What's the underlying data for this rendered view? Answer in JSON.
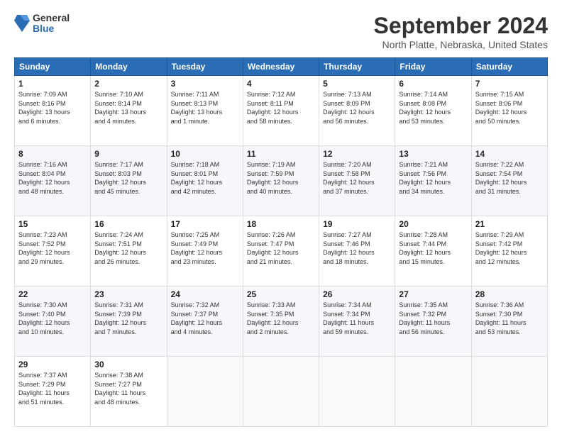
{
  "header": {
    "logo": {
      "general": "General",
      "blue": "Blue"
    },
    "title": "September 2024",
    "location": "North Platte, Nebraska, United States"
  },
  "calendar": {
    "headers": [
      "Sunday",
      "Monday",
      "Tuesday",
      "Wednesday",
      "Thursday",
      "Friday",
      "Saturday"
    ],
    "weeks": [
      [
        {
          "day": "1",
          "info": "Sunrise: 7:09 AM\nSunset: 8:16 PM\nDaylight: 13 hours\nand 6 minutes."
        },
        {
          "day": "2",
          "info": "Sunrise: 7:10 AM\nSunset: 8:14 PM\nDaylight: 13 hours\nand 4 minutes."
        },
        {
          "day": "3",
          "info": "Sunrise: 7:11 AM\nSunset: 8:13 PM\nDaylight: 13 hours\nand 1 minute."
        },
        {
          "day": "4",
          "info": "Sunrise: 7:12 AM\nSunset: 8:11 PM\nDaylight: 12 hours\nand 58 minutes."
        },
        {
          "day": "5",
          "info": "Sunrise: 7:13 AM\nSunset: 8:09 PM\nDaylight: 12 hours\nand 56 minutes."
        },
        {
          "day": "6",
          "info": "Sunrise: 7:14 AM\nSunset: 8:08 PM\nDaylight: 12 hours\nand 53 minutes."
        },
        {
          "day": "7",
          "info": "Sunrise: 7:15 AM\nSunset: 8:06 PM\nDaylight: 12 hours\nand 50 minutes."
        }
      ],
      [
        {
          "day": "8",
          "info": "Sunrise: 7:16 AM\nSunset: 8:04 PM\nDaylight: 12 hours\nand 48 minutes."
        },
        {
          "day": "9",
          "info": "Sunrise: 7:17 AM\nSunset: 8:03 PM\nDaylight: 12 hours\nand 45 minutes."
        },
        {
          "day": "10",
          "info": "Sunrise: 7:18 AM\nSunset: 8:01 PM\nDaylight: 12 hours\nand 42 minutes."
        },
        {
          "day": "11",
          "info": "Sunrise: 7:19 AM\nSunset: 7:59 PM\nDaylight: 12 hours\nand 40 minutes."
        },
        {
          "day": "12",
          "info": "Sunrise: 7:20 AM\nSunset: 7:58 PM\nDaylight: 12 hours\nand 37 minutes."
        },
        {
          "day": "13",
          "info": "Sunrise: 7:21 AM\nSunset: 7:56 PM\nDaylight: 12 hours\nand 34 minutes."
        },
        {
          "day": "14",
          "info": "Sunrise: 7:22 AM\nSunset: 7:54 PM\nDaylight: 12 hours\nand 31 minutes."
        }
      ],
      [
        {
          "day": "15",
          "info": "Sunrise: 7:23 AM\nSunset: 7:52 PM\nDaylight: 12 hours\nand 29 minutes."
        },
        {
          "day": "16",
          "info": "Sunrise: 7:24 AM\nSunset: 7:51 PM\nDaylight: 12 hours\nand 26 minutes."
        },
        {
          "day": "17",
          "info": "Sunrise: 7:25 AM\nSunset: 7:49 PM\nDaylight: 12 hours\nand 23 minutes."
        },
        {
          "day": "18",
          "info": "Sunrise: 7:26 AM\nSunset: 7:47 PM\nDaylight: 12 hours\nand 21 minutes."
        },
        {
          "day": "19",
          "info": "Sunrise: 7:27 AM\nSunset: 7:46 PM\nDaylight: 12 hours\nand 18 minutes."
        },
        {
          "day": "20",
          "info": "Sunrise: 7:28 AM\nSunset: 7:44 PM\nDaylight: 12 hours\nand 15 minutes."
        },
        {
          "day": "21",
          "info": "Sunrise: 7:29 AM\nSunset: 7:42 PM\nDaylight: 12 hours\nand 12 minutes."
        }
      ],
      [
        {
          "day": "22",
          "info": "Sunrise: 7:30 AM\nSunset: 7:40 PM\nDaylight: 12 hours\nand 10 minutes."
        },
        {
          "day": "23",
          "info": "Sunrise: 7:31 AM\nSunset: 7:39 PM\nDaylight: 12 hours\nand 7 minutes."
        },
        {
          "day": "24",
          "info": "Sunrise: 7:32 AM\nSunset: 7:37 PM\nDaylight: 12 hours\nand 4 minutes."
        },
        {
          "day": "25",
          "info": "Sunrise: 7:33 AM\nSunset: 7:35 PM\nDaylight: 12 hours\nand 2 minutes."
        },
        {
          "day": "26",
          "info": "Sunrise: 7:34 AM\nSunset: 7:34 PM\nDaylight: 11 hours\nand 59 minutes."
        },
        {
          "day": "27",
          "info": "Sunrise: 7:35 AM\nSunset: 7:32 PM\nDaylight: 11 hours\nand 56 minutes."
        },
        {
          "day": "28",
          "info": "Sunrise: 7:36 AM\nSunset: 7:30 PM\nDaylight: 11 hours\nand 53 minutes."
        }
      ],
      [
        {
          "day": "29",
          "info": "Sunrise: 7:37 AM\nSunset: 7:29 PM\nDaylight: 11 hours\nand 51 minutes."
        },
        {
          "day": "30",
          "info": "Sunrise: 7:38 AM\nSunset: 7:27 PM\nDaylight: 11 hours\nand 48 minutes."
        },
        {
          "day": "",
          "info": ""
        },
        {
          "day": "",
          "info": ""
        },
        {
          "day": "",
          "info": ""
        },
        {
          "day": "",
          "info": ""
        },
        {
          "day": "",
          "info": ""
        }
      ]
    ]
  }
}
